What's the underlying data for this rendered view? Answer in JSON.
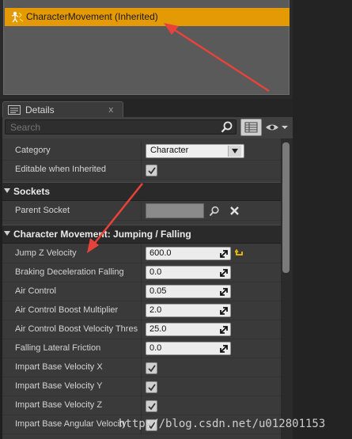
{
  "components": {
    "selected_label": "CharacterMovement (Inherited)"
  },
  "details_tab": {
    "label": "Details",
    "close": "x"
  },
  "search": {
    "placeholder": "Search"
  },
  "properties": {
    "category_label": "Category",
    "category_value": "Character",
    "editable_label": "Editable when Inherited",
    "editable_checked": true
  },
  "sockets": {
    "header": "Sockets",
    "parent_socket_label": "Parent Socket"
  },
  "jumping": {
    "header": "Character Movement: Jumping / Falling",
    "rows": [
      {
        "label": "Jump Z Velocity",
        "value": "600.0"
      },
      {
        "label": "Braking Deceleration Falling",
        "value": "0.0"
      },
      {
        "label": "Air Control",
        "value": "0.05"
      },
      {
        "label": "Air Control Boost Multiplier",
        "value": "2.0"
      },
      {
        "label": "Air Control Boost Velocity Thres",
        "value": "25.0"
      },
      {
        "label": "Falling Lateral Friction",
        "value": "0.0"
      }
    ],
    "checks": [
      {
        "label": "Impart Base Velocity X",
        "checked": true
      },
      {
        "label": "Impart Base Velocity Y",
        "checked": true
      },
      {
        "label": "Impart Base Velocity Z",
        "checked": true
      },
      {
        "label": "Impart Base Angular Velocity",
        "checked": true
      }
    ]
  },
  "watermark": "http://blog.csdn.net/u012801153",
  "colors": {
    "selection": "#e39a05",
    "annotation_arrow": "#e8433a"
  }
}
